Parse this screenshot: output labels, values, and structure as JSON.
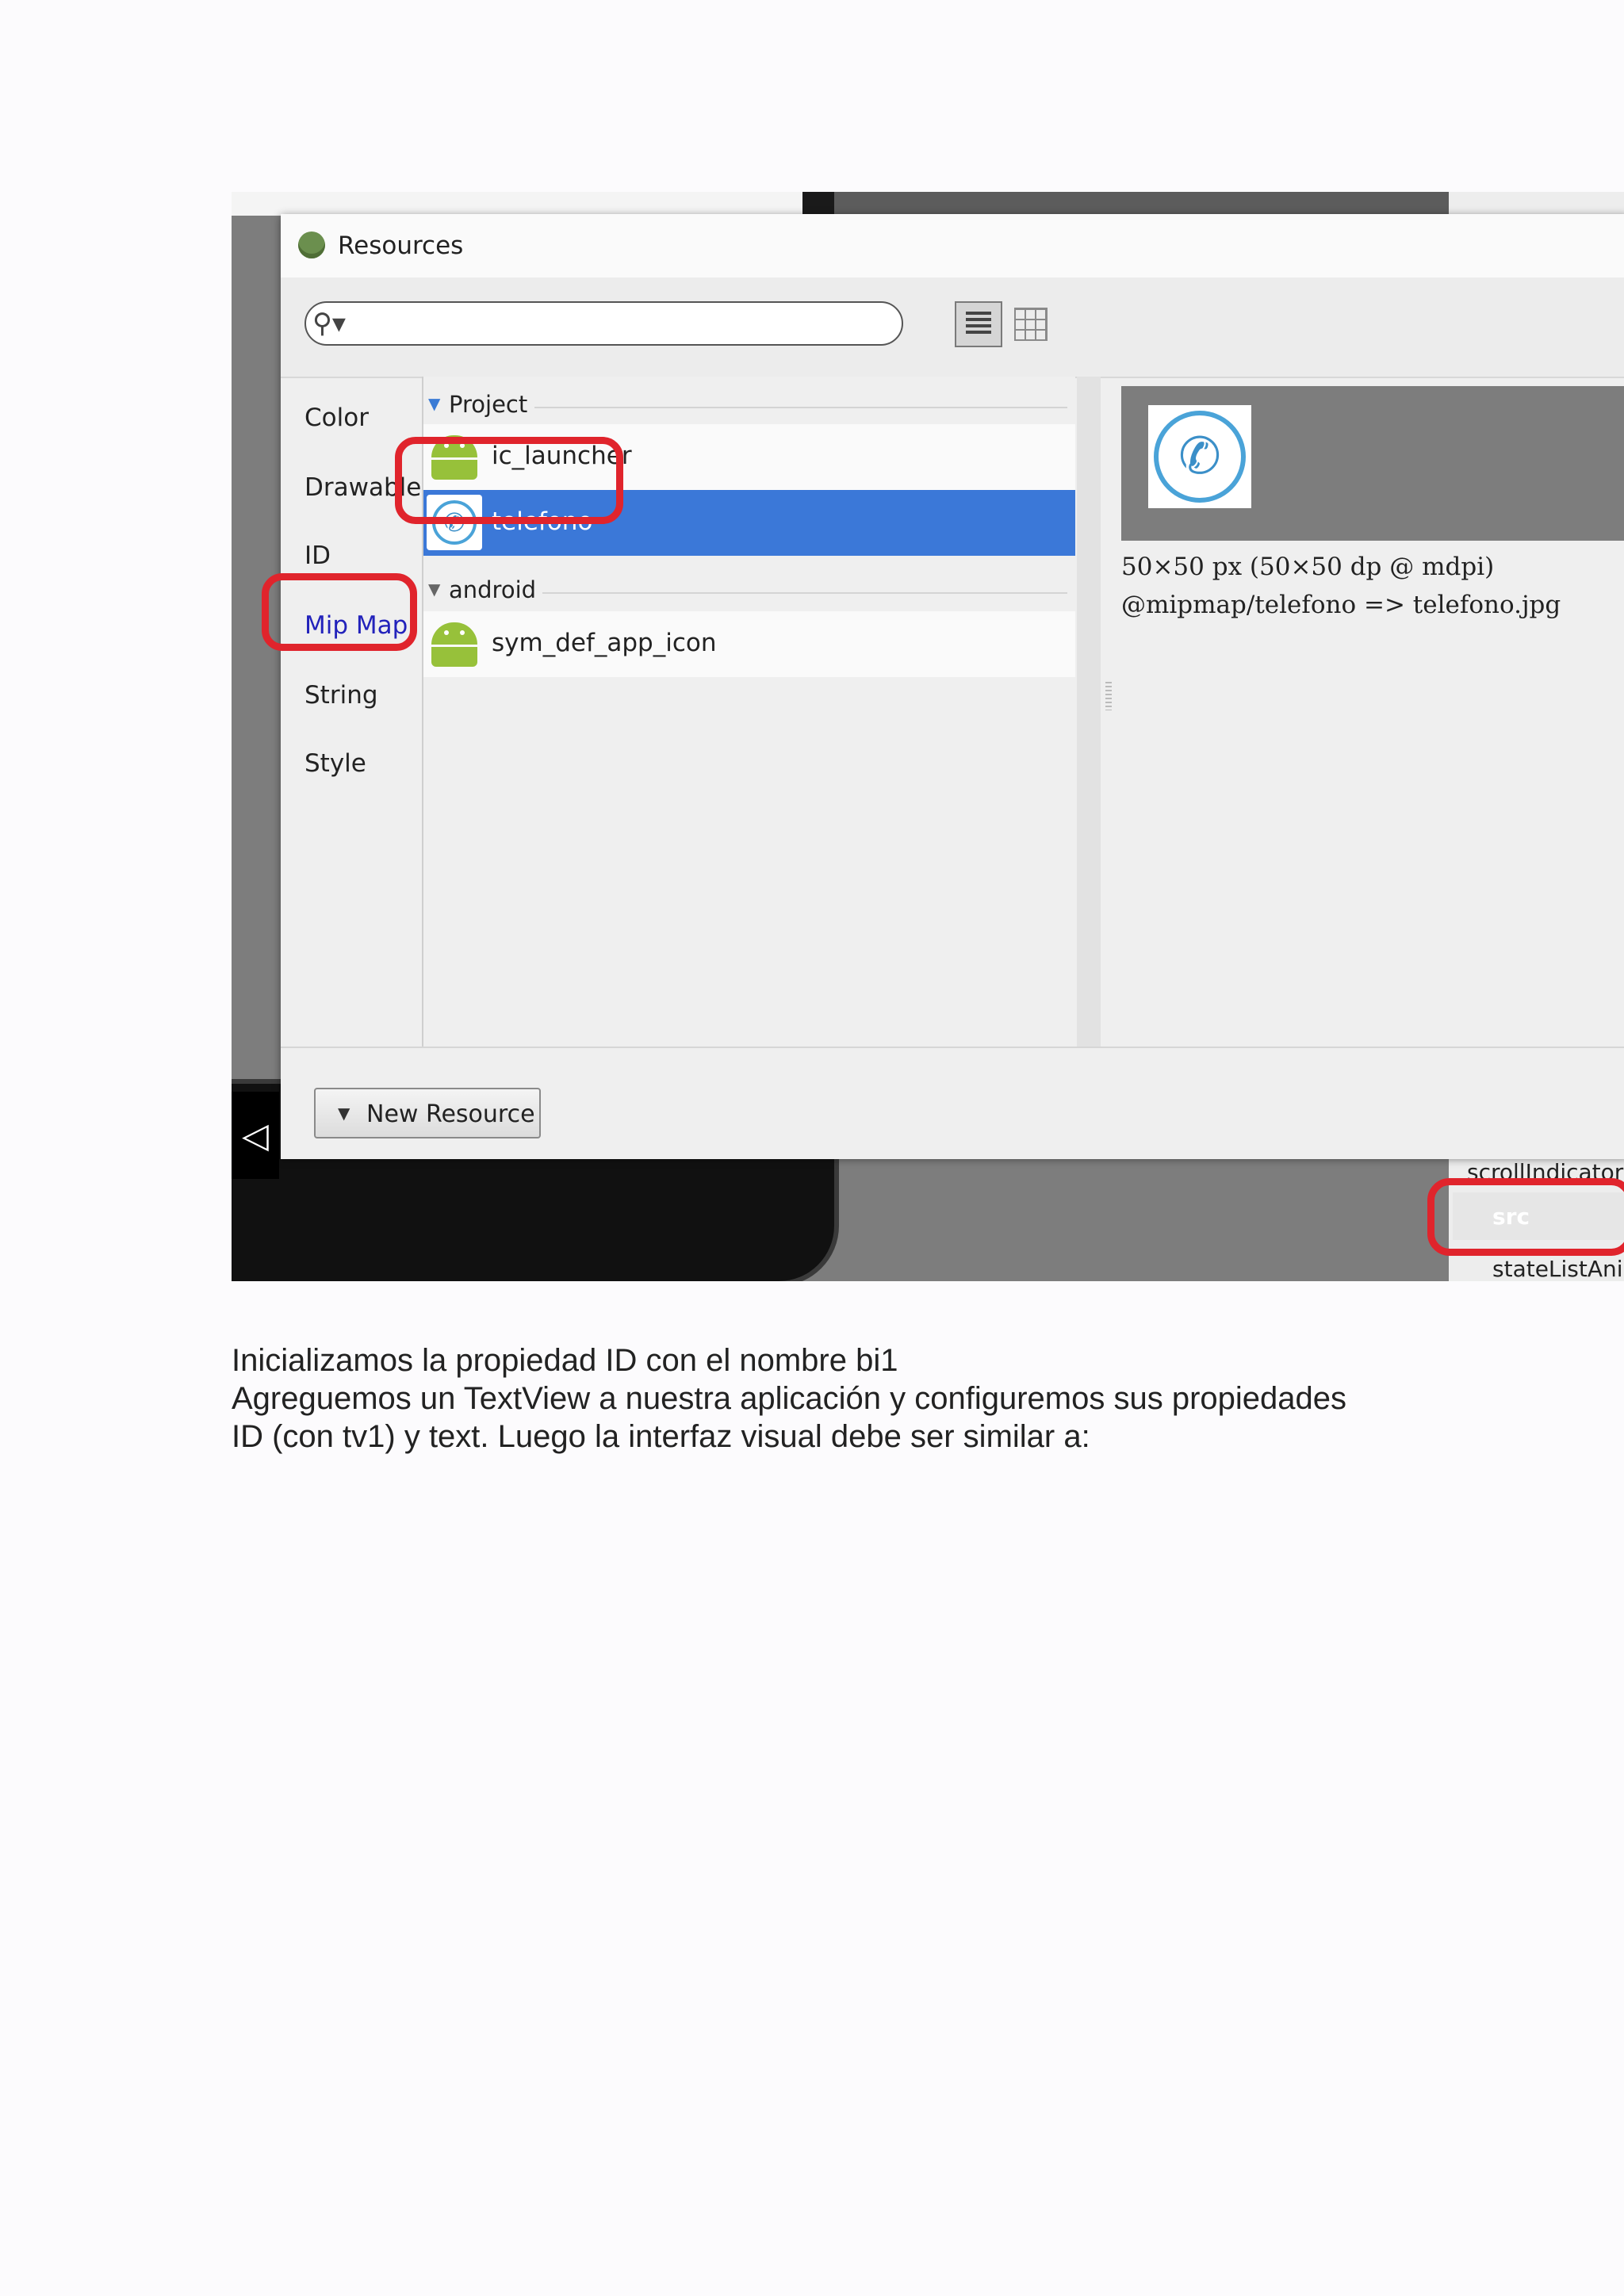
{
  "dialog": {
    "title": "Resources",
    "search": {
      "value": ""
    },
    "categories": [
      "Color",
      "Drawable",
      "ID",
      "Mip Map",
      "String",
      "Style"
    ],
    "selected_category": "Mip Map",
    "groups": [
      {
        "name": "Project",
        "items": [
          "ic_launcher",
          "telefono"
        ]
      },
      {
        "name": "android",
        "items": [
          "sym_def_app_icon"
        ]
      }
    ],
    "selected_item": "telefono",
    "preview": {
      "size_text": "50×50 px (50×50 dp @ mdpi)",
      "path_text": "@mipmap/telefono => telefono.jpg"
    },
    "new_resource_label": "New Resource"
  },
  "background": {
    "properties": [
      "scrollIndicators",
      "src",
      "stateListAnimator"
    ],
    "back_icon": "◁"
  },
  "highlight_color": "#e0242c",
  "selection_color": "#3b78d8",
  "paragraphs": [
    "Inicializamos la propiedad ID con el nombre bi1",
    "Agreguemos un TextView a nuestra aplicación y configuremos sus propiedades",
    "ID (con tv1) y text. Luego la interfaz visual debe ser similar a:"
  ]
}
